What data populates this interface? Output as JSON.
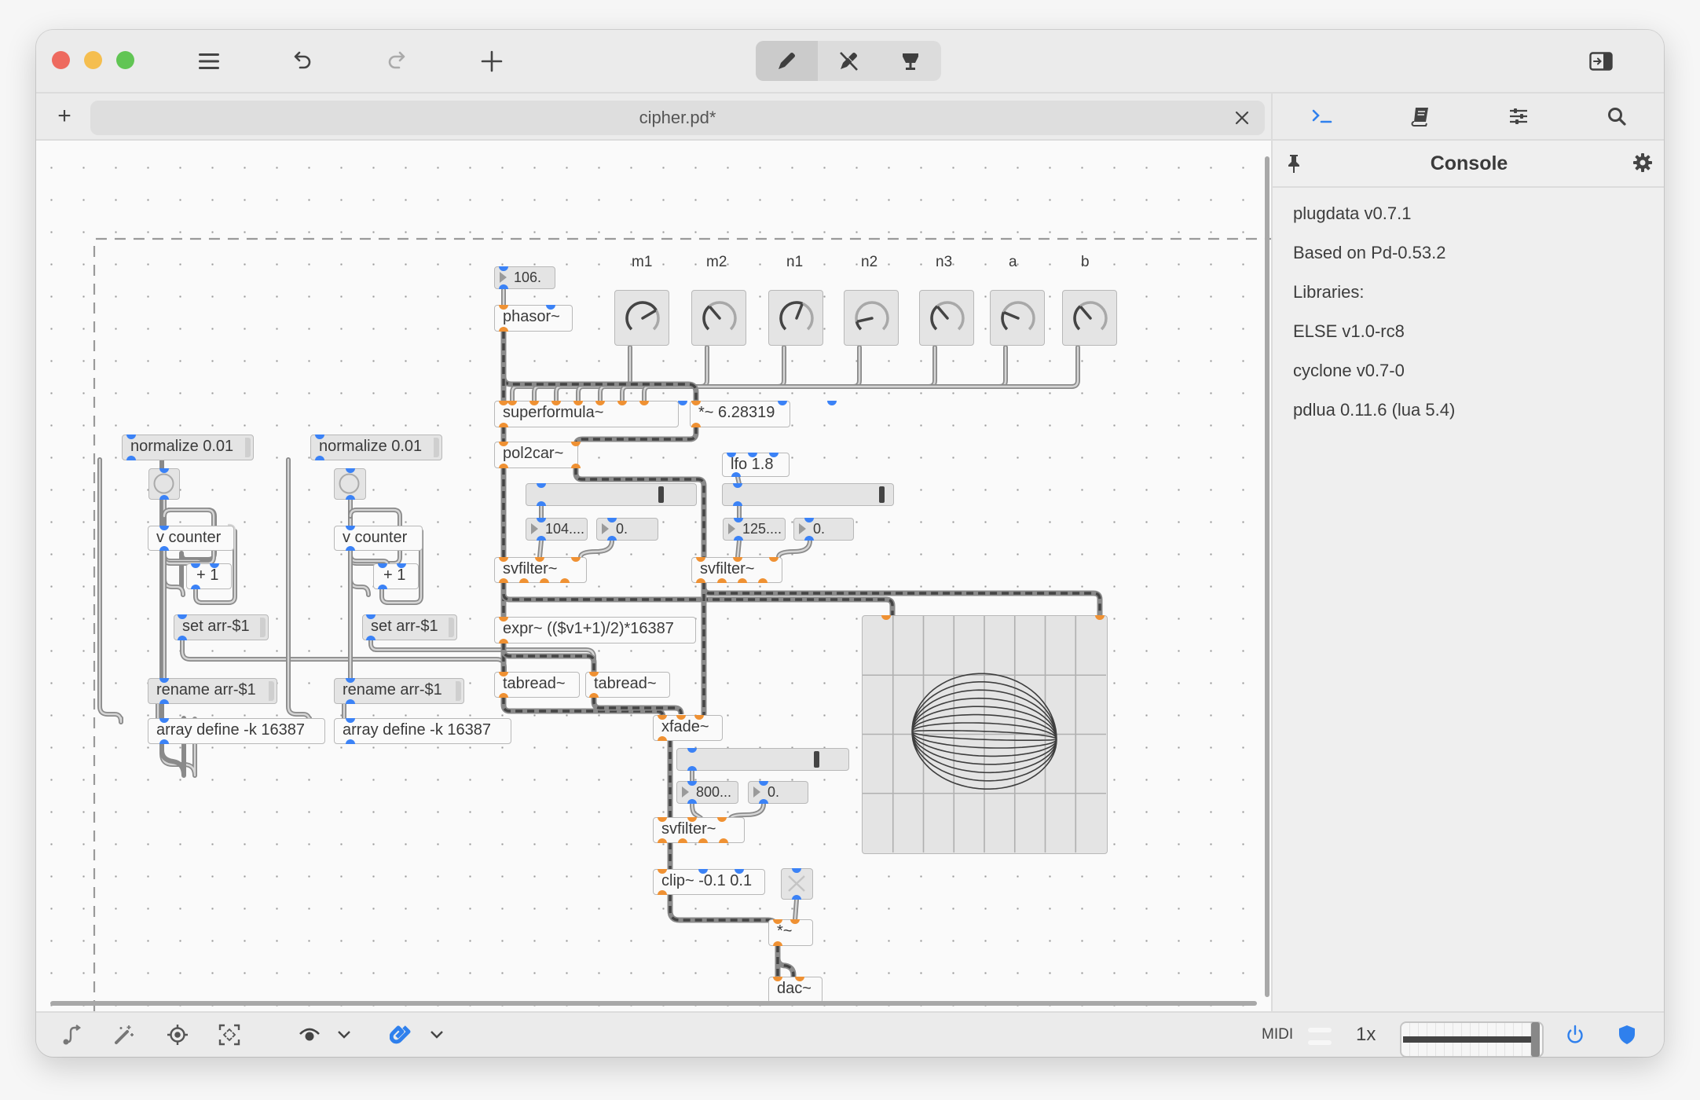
{
  "window": {
    "traffic_lights": {
      "close": "#ee6a5f",
      "minimize": "#f5be4f",
      "zoom": "#61c554"
    },
    "toolbar": {
      "menu_icon": "hamburger-menu-icon",
      "undo_icon": "undo-icon",
      "redo_icon": "redo-icon",
      "add_icon": "plus-icon",
      "modes": [
        {
          "name": "edit-mode",
          "icon": "pencil-icon",
          "active": true
        },
        {
          "name": "run-mode",
          "icon": "pencil-crossed-icon",
          "active": false
        },
        {
          "name": "presentation-mode",
          "icon": "presentation-icon",
          "active": false
        }
      ],
      "sidebar_toggle_icon": "sidebar-toggle-icon"
    },
    "tabbar": {
      "new_tab_label": "+",
      "tabs": [
        {
          "title": "cipher.pd*",
          "close": "×"
        }
      ]
    }
  },
  "sidebar": {
    "tabs": [
      {
        "name": "console",
        "icon": "terminal-icon",
        "active": true
      },
      {
        "name": "documentation",
        "icon": "book-icon",
        "active": false
      },
      {
        "name": "inspector",
        "icon": "sliders-icon",
        "active": false
      },
      {
        "name": "search",
        "icon": "search-icon",
        "active": false
      }
    ],
    "panel_title": "Console",
    "console_lines": [
      "plugdata v0.7.1",
      "Based on Pd-0.53.2",
      "Libraries:",
      "ELSE v1.0-rc8",
      "cyclone v0.7-0",
      "pdlua 0.11.6 (lua 5.4)"
    ]
  },
  "bottombar": {
    "left_icons": [
      "connection-style-icon",
      "autopatch-wand-icon",
      "zoom-locate-icon",
      "zoom-fit-icon",
      "visibility-icon",
      "chevron-down-icon",
      "magnet-snap-icon",
      "chevron-down-icon"
    ],
    "midi_label": "MIDI",
    "oversampling_label": "1x",
    "volume": 1.0,
    "power_on": true,
    "protection_on": true,
    "accent": "#2f80ed"
  },
  "patch": {
    "knob_labels": [
      "m1",
      "m2",
      "n1",
      "n2",
      "n3",
      "a",
      "b"
    ],
    "knob_values": [
      0.72,
      0.35,
      0.58,
      0.12,
      0.35,
      0.25,
      0.35
    ],
    "objects": {
      "freq_numbox": "106.",
      "phasor": "phasor~",
      "superformula": "superformula~",
      "mul_twopi": "*~ 6.28319",
      "pol2car": "pol2car~",
      "lfo": "lfo 1.8",
      "numbox_a1": "104....",
      "numbox_a2": "0.",
      "numbox_b1": "125....",
      "numbox_b2": "0.",
      "svfilter_a": "svfilter~",
      "svfilter_b": "svfilter~",
      "expr": "expr~ (($v1+1)/2)*16387",
      "tabread_a": "tabread~",
      "tabread_b": "tabread~",
      "xfade": "xfade~",
      "numbox_c1": "800...",
      "numbox_c2": "0.",
      "svfilter_c": "svfilter~",
      "clip": "clip~ -0.1 0.1",
      "mul": "*~",
      "dac": "dac~",
      "normalize_a": "normalize 0.01",
      "normalize_b": "normalize 0.01",
      "counter_a": "v counter",
      "counter_b": "v counter",
      "plus_a": "+ 1",
      "plus_b": "+ 1",
      "set_a": "set arr-$1",
      "set_b": "set arr-$1",
      "rename_a": "rename arr-$1",
      "rename_b": "rename arr-$1",
      "array_a": "array define -k 16387",
      "array_b": "array define -k 16387"
    },
    "slider_values": {
      "slider_a": 0.83,
      "slider_b": 0.98,
      "slider_c": 0.85
    },
    "toggle_on": false
  }
}
